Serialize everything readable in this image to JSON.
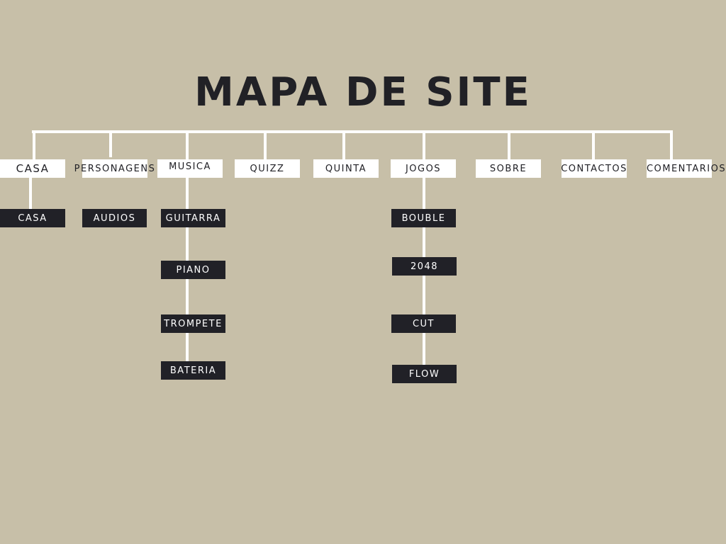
{
  "title": "MAPA DE SITE",
  "colors": {
    "background": "#c7bfa8",
    "line": "#ffffff",
    "top_box": "#ffffff",
    "top_text": "#212126",
    "sub_box": "#212127",
    "sub_text": "#ffffff"
  },
  "nodes": {
    "casa": {
      "label": "CASA",
      "children": [
        "CASA"
      ]
    },
    "personagens": {
      "label": "PERSONAGENS",
      "children": [
        "AUDIOS"
      ]
    },
    "musica": {
      "label": "MUSICA",
      "children": [
        "GUITARRA",
        "PIANO",
        "TROMPETE",
        "BATERIA"
      ]
    },
    "quizz": {
      "label": "QUIZZ",
      "children": []
    },
    "quinta": {
      "label": "QUINTA",
      "children": []
    },
    "jogos": {
      "label": "JOGOS",
      "children": [
        "BOUBLE",
        "2048",
        "CUT",
        "FLOW"
      ]
    },
    "sobre": {
      "label": "SOBRE",
      "children": []
    },
    "contactos": {
      "label": "CONTACTOS",
      "children": []
    },
    "comentarios": {
      "label": "COMENTARIOS",
      "children": []
    }
  }
}
